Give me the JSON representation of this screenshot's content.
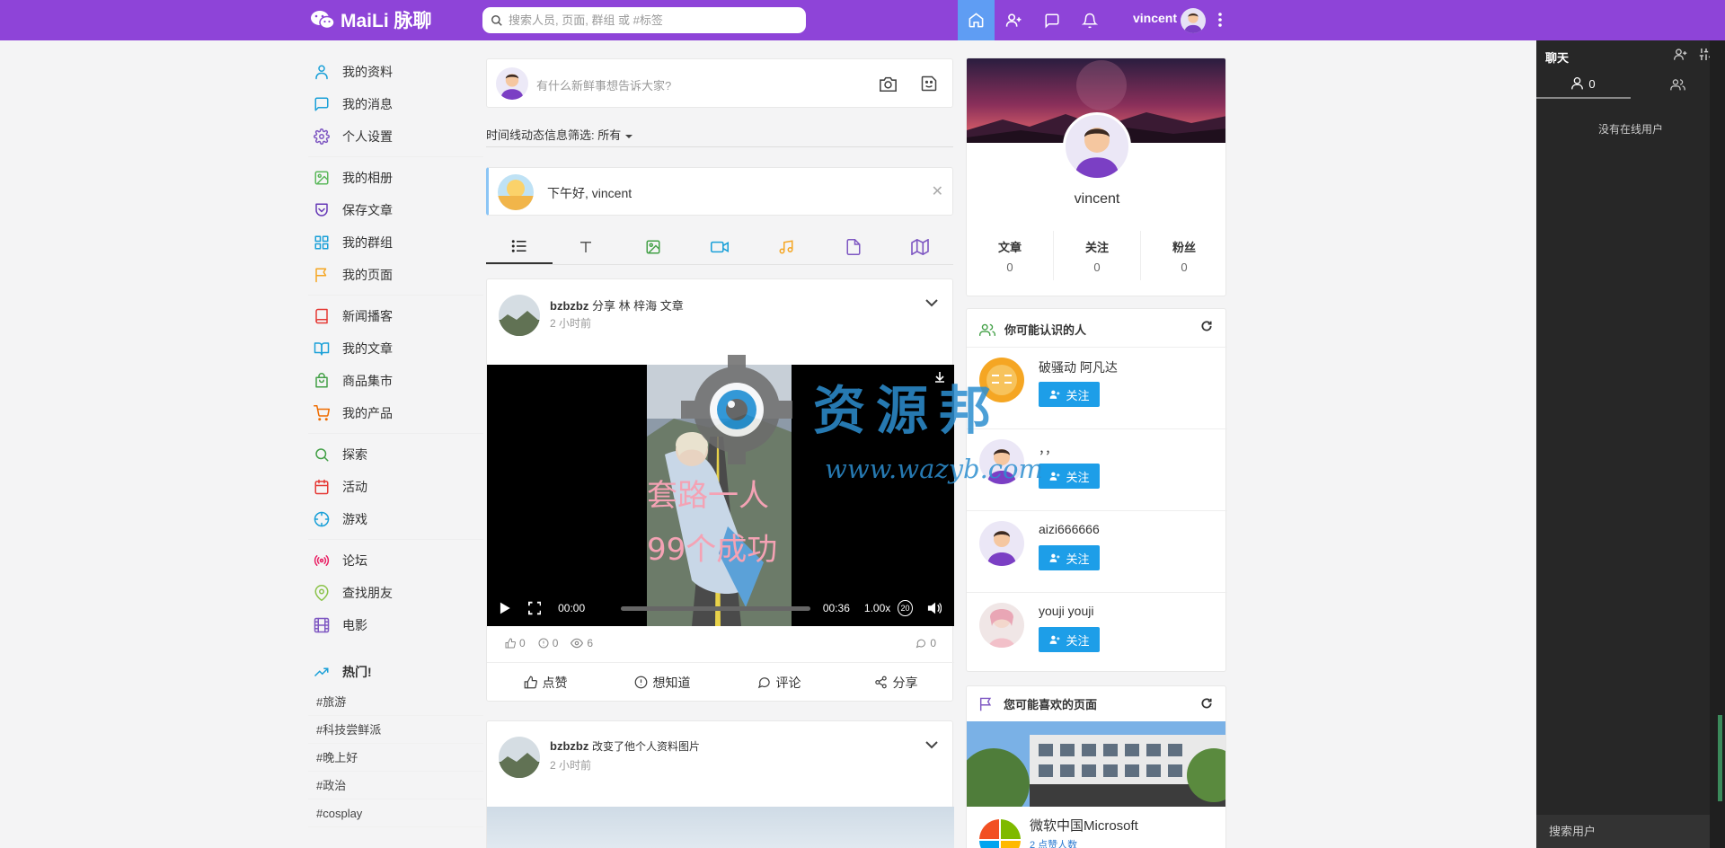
{
  "header": {
    "logo": "MaiLi 脉聊",
    "search_placeholder": "搜索人员, 页面, 群组 或 #标签",
    "username": "vincent",
    "colors": {
      "bar": "#8e44d8",
      "active": "#5f9df3"
    }
  },
  "sidebar": {
    "groups": [
      [
        {
          "label": "我的资料",
          "icon": "user-icon",
          "color": "#1aa0d8"
        },
        {
          "label": "我的消息",
          "icon": "message-icon",
          "color": "#1aa0d8"
        },
        {
          "label": "个人设置",
          "icon": "gear-icon",
          "color": "#7e57c2"
        }
      ],
      [
        {
          "label": "我的相册",
          "icon": "image-icon",
          "color": "#5cb85c"
        },
        {
          "label": "保存文章",
          "icon": "save-icon",
          "color": "#673ab7"
        },
        {
          "label": "我的群组",
          "icon": "grid-icon",
          "color": "#1aa0d8"
        },
        {
          "label": "我的页面",
          "icon": "flag-icon",
          "color": "#f5a623"
        }
      ],
      [
        {
          "label": "新闻播客",
          "icon": "book-icon",
          "color": "#e53935"
        },
        {
          "label": "我的文章",
          "icon": "open-book-icon",
          "color": "#1aa0d8"
        },
        {
          "label": "商品集市",
          "icon": "bag-icon",
          "color": "#43a047"
        },
        {
          "label": "我的产品",
          "icon": "cart-icon",
          "color": "#ef6c00"
        }
      ],
      [
        {
          "label": "探索",
          "icon": "search-icon",
          "color": "#43a047"
        },
        {
          "label": "活动",
          "icon": "calendar-icon",
          "color": "#e53935"
        },
        {
          "label": "游戏",
          "icon": "crosshair-icon",
          "color": "#1aa0d8"
        }
      ],
      [
        {
          "label": "论坛",
          "icon": "broadcast-icon",
          "color": "#e91e63"
        },
        {
          "label": "查找朋友",
          "icon": "map-pin-icon",
          "color": "#8bc34a"
        },
        {
          "label": "电影",
          "icon": "film-icon",
          "color": "#7e57c2"
        }
      ]
    ],
    "trending_title": "热门!",
    "trending": [
      "#旅游",
      "#科技尝鲜派",
      "#晚上好",
      "#政治",
      "#cosplay"
    ]
  },
  "composer": {
    "placeholder": "有什么新鲜事想告诉大家?"
  },
  "filter": {
    "label": "时间线动态信息筛选:",
    "value": "所有"
  },
  "greeting": {
    "text": "下午好, vincent"
  },
  "tabs": [
    "list-icon",
    "text-icon",
    "image-icon",
    "video-icon",
    "music-icon",
    "file-icon",
    "map-icon"
  ],
  "post1": {
    "author": "bzbzbz",
    "action": "分享 林 梓海 文章",
    "time": "2 小时前",
    "caption_line1": "套路一人",
    "caption_line2": "99个成功",
    "video": {
      "current": "00:00",
      "duration": "00:36",
      "speed": "1.00x",
      "rewind": "20"
    },
    "likes": "0",
    "wonders": "0",
    "views": "6",
    "comments": "0",
    "actions": [
      "点赞",
      "想知道",
      "评论",
      "分享"
    ]
  },
  "post2": {
    "author": "bzbzbz",
    "action": "改变了他个人资料图片",
    "time": "2 小时前"
  },
  "profile": {
    "name": "vincent",
    "stats": [
      {
        "label": "文章",
        "value": "0"
      },
      {
        "label": "关注",
        "value": "0"
      },
      {
        "label": "粉丝",
        "value": "0"
      }
    ]
  },
  "know": {
    "title": "你可能认识的人",
    "follow_label": "关注",
    "people": [
      {
        "name": "破骚动 阿凡达"
      },
      {
        "name": "，，"
      },
      {
        "name": "aizi666666"
      },
      {
        "name": "youji youji"
      }
    ]
  },
  "pages": {
    "title": "您可能喜欢的页面",
    "name": "微软中国Microsoft",
    "sub": "2 点赞人数"
  },
  "chat": {
    "title": "聊天",
    "online_count": "0",
    "empty": "没有在线用户",
    "search_placeholder": "搜索用户"
  },
  "watermark": {
    "text": "资源邦",
    "url": "www.wazyb.com"
  }
}
